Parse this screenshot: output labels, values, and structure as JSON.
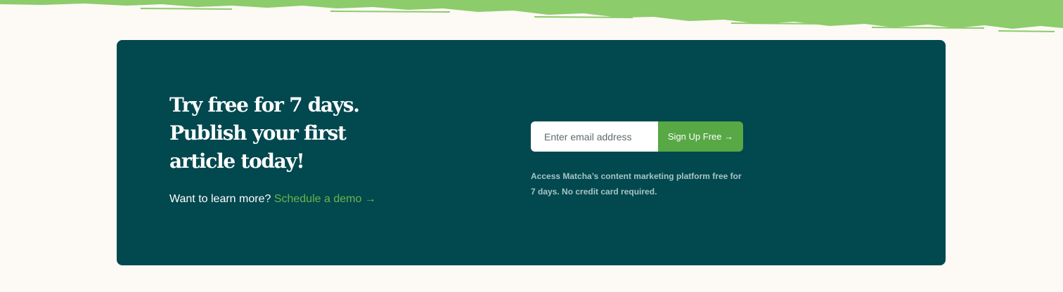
{
  "colors": {
    "page_background": "#fdf9f5",
    "card_background": "#02484f",
    "accent_green": "#58a845",
    "link_green": "#6ab54a",
    "brush_green": "#8ccc6b",
    "disclaimer_text": "#a7c4c4"
  },
  "decoration": {
    "top_border": "green-brush-stroke"
  },
  "cta": {
    "headline": "Try free for 7 days. Publish your first article today!",
    "learn_more_text": "Want to learn more?",
    "demo_link_label": "Schedule a demo →"
  },
  "signup": {
    "email_placeholder": "Enter email address",
    "email_value": "",
    "button_label": "Sign Up Free →",
    "disclaimer": "Access Matcha’s content marketing platform free for 7 days. No credit card required."
  }
}
